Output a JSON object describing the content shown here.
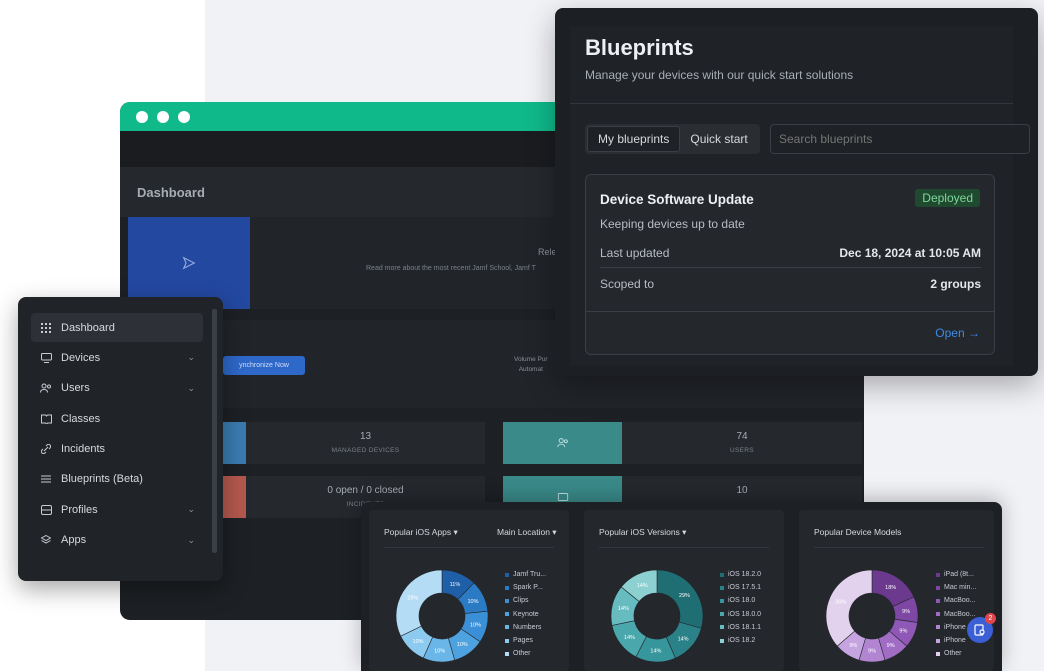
{
  "dashboard": {
    "title": "Dashboard",
    "banner_title": "Rele",
    "banner_sub": "Read more about the most recent Jamf School, Jamf T",
    "sync_button": "ynchronize Now",
    "vpp_line1": "Volume Pur",
    "vpp_line2": "Automat",
    "stats": [
      {
        "value": "13",
        "label": "MANAGED DEVICES"
      },
      {
        "value": "74",
        "label": "USERS"
      },
      {
        "value": "0 open / 0 closed",
        "label": "INCIDENTS"
      },
      {
        "value": "10",
        "label": ""
      }
    ]
  },
  "sidebar": {
    "items": [
      {
        "label": "Dashboard",
        "icon": "grid-icon"
      },
      {
        "label": "Devices",
        "icon": "monitor-icon"
      },
      {
        "label": "Users",
        "icon": "users-icon"
      },
      {
        "label": "Classes",
        "icon": "book-icon"
      },
      {
        "label": "Incidents",
        "icon": "link-icon"
      },
      {
        "label": "Blueprints (Beta)",
        "icon": "sliders-icon"
      },
      {
        "label": "Profiles",
        "icon": "inbox-icon"
      },
      {
        "label": "Apps",
        "icon": "layers-icon"
      }
    ]
  },
  "blueprints": {
    "title": "Blueprints",
    "subtitle": "Manage your devices with our quick start solutions",
    "tab_my": "My blueprints",
    "tab_quick": "Quick start",
    "search_placeholder": "Search blueprints",
    "card": {
      "title": "Device Software Update",
      "status": "Deployed",
      "description": "Keeping devices up to date",
      "last_updated_label": "Last updated",
      "last_updated_value": "Dec 18, 2024 at 10:05 AM",
      "scoped_label": "Scoped to",
      "scoped_value": "2 groups",
      "open_label": "Open →"
    }
  },
  "charts_panel": {
    "apps": {
      "title": "Popular iOS Apps ▾",
      "location": "Main Location ▾",
      "legend": [
        "Jamf Tru...",
        "Spark P...",
        "Clips",
        "Keynote",
        "Numbers",
        "Pages",
        "Other"
      ],
      "slice_labels": [
        "11%",
        "10%",
        "10%",
        "10%",
        "10%",
        "10%",
        "29%"
      ],
      "colors": [
        "#1e5fa8",
        "#2a7bc4",
        "#3a8fd6",
        "#4ea2e0",
        "#6ab6e8",
        "#8ccaf0",
        "#b5dcf5"
      ]
    },
    "versions": {
      "title": "Popular iOS Versions ▾",
      "legend": [
        "iOS 18.2.0",
        "iOS 17.5.1",
        "iOS 18.0",
        "iOS 18.0.0",
        "iOS 18.1.1",
        "iOS 18.2"
      ],
      "slice_labels": [
        "29%",
        "14%",
        "14%",
        "14%",
        "14%",
        "14%"
      ],
      "colors": [
        "#1f6e73",
        "#2a8288",
        "#36969b",
        "#4aa8ac",
        "#66bcbf",
        "#8dd0d2"
      ]
    },
    "models": {
      "title": "Popular Device Models",
      "legend": [
        "iPad (8t...",
        "Mac min...",
        "MacBoo...",
        "MacBoo...",
        "iPhone S...",
        "iPhone",
        "Other"
      ],
      "slice_labels": [
        "18%",
        "9%",
        "9%",
        "9%",
        "9%",
        "9%",
        "36%"
      ],
      "colors": [
        "#6b3a8f",
        "#7d47a3",
        "#8f58b6",
        "#a06cc4",
        "#b285d2",
        "#c6a4df",
        "#e2d2ee"
      ]
    },
    "notification_count": "2"
  }
}
